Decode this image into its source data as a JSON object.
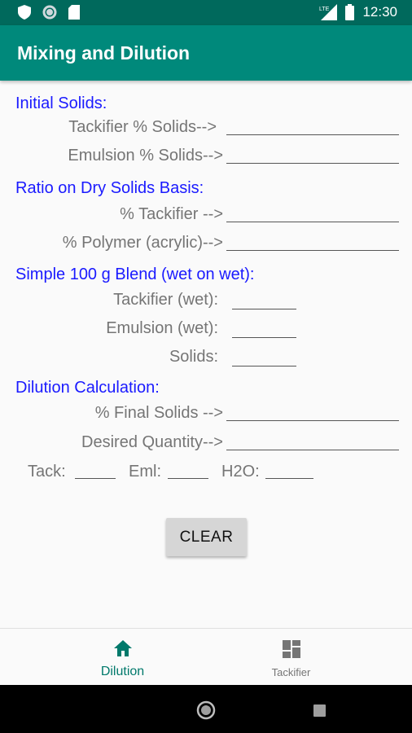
{
  "status_bar": {
    "time": "12:30",
    "network_label": "LTE"
  },
  "app_bar": {
    "title": "Mixing and Dilution"
  },
  "sections": {
    "initial_solids": {
      "heading": "Initial Solids:",
      "tackifier_label": "Tackifier % Solids-->",
      "emulsion_label": "Emulsion % Solids-->",
      "tackifier_value": "",
      "emulsion_value": ""
    },
    "ratio": {
      "heading": "Ratio on  Dry Solids Basis:",
      "tackifier_label": "% Tackifier -->",
      "polymer_label": "% Polymer (acrylic)-->",
      "tackifier_value": "",
      "polymer_value": ""
    },
    "blend": {
      "heading": "Simple 100 g Blend (wet on wet):",
      "tackifier_label": "Tackifier (wet):",
      "emulsion_label": "Emulsion (wet):",
      "solids_label": "Solids:",
      "tackifier_value": "",
      "emulsion_value": "",
      "solids_value": ""
    },
    "dilution": {
      "heading": "Dilution Calculation:",
      "final_solids_label": "% Final Solids -->",
      "desired_quantity_label": "Desired Quantity-->",
      "final_solids_value": "",
      "desired_quantity_value": "",
      "tack_label": "Tack:",
      "eml_label": "Eml:",
      "h2o_label": "H2O:",
      "tack_value": "",
      "eml_value": "",
      "h2o_value": ""
    }
  },
  "clear_button": {
    "label": "CLEAR"
  },
  "bottom_nav": {
    "items": [
      {
        "label": "Dilution",
        "icon": "home-icon",
        "active": true
      },
      {
        "label": "Tackifier",
        "icon": "dashboard-icon",
        "active": false
      }
    ]
  },
  "colors": {
    "status_bar": "#00695c",
    "app_bar": "#00897b",
    "heading_text": "#1a1aff",
    "label_text": "#757575",
    "nav_active": "#00796b"
  }
}
